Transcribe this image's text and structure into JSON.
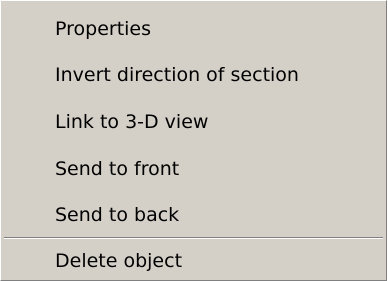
{
  "context_menu": {
    "items": [
      {
        "label": "Properties"
      },
      {
        "label": "Invert direction of section"
      },
      {
        "label": "Link to 3-D view"
      },
      {
        "label": "Send to front"
      },
      {
        "label": "Send to back"
      },
      {
        "label": "Delete object"
      }
    ]
  },
  "colors": {
    "menu_background": "#d4d0c8",
    "text": "#000000",
    "separator_shadow": "#808080",
    "separator_highlight": "#ffffff"
  }
}
